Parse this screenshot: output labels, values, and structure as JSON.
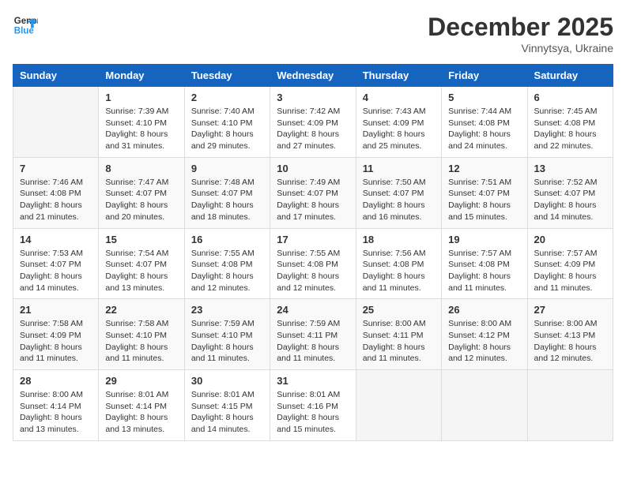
{
  "header": {
    "logo_line1": "General",
    "logo_line2": "Blue",
    "month_year": "December 2025",
    "location": "Vinnytsya, Ukraine"
  },
  "weekdays": [
    "Sunday",
    "Monday",
    "Tuesday",
    "Wednesday",
    "Thursday",
    "Friday",
    "Saturday"
  ],
  "weeks": [
    [
      {
        "day": "",
        "sunrise": "",
        "sunset": "",
        "daylight": ""
      },
      {
        "day": "1",
        "sunrise": "7:39 AM",
        "sunset": "4:10 PM",
        "daylight": "8 hours and 31 minutes."
      },
      {
        "day": "2",
        "sunrise": "7:40 AM",
        "sunset": "4:10 PM",
        "daylight": "8 hours and 29 minutes."
      },
      {
        "day": "3",
        "sunrise": "7:42 AM",
        "sunset": "4:09 PM",
        "daylight": "8 hours and 27 minutes."
      },
      {
        "day": "4",
        "sunrise": "7:43 AM",
        "sunset": "4:09 PM",
        "daylight": "8 hours and 25 minutes."
      },
      {
        "day": "5",
        "sunrise": "7:44 AM",
        "sunset": "4:08 PM",
        "daylight": "8 hours and 24 minutes."
      },
      {
        "day": "6",
        "sunrise": "7:45 AM",
        "sunset": "4:08 PM",
        "daylight": "8 hours and 22 minutes."
      }
    ],
    [
      {
        "day": "7",
        "sunrise": "7:46 AM",
        "sunset": "4:08 PM",
        "daylight": "8 hours and 21 minutes."
      },
      {
        "day": "8",
        "sunrise": "7:47 AM",
        "sunset": "4:07 PM",
        "daylight": "8 hours and 20 minutes."
      },
      {
        "day": "9",
        "sunrise": "7:48 AM",
        "sunset": "4:07 PM",
        "daylight": "8 hours and 18 minutes."
      },
      {
        "day": "10",
        "sunrise": "7:49 AM",
        "sunset": "4:07 PM",
        "daylight": "8 hours and 17 minutes."
      },
      {
        "day": "11",
        "sunrise": "7:50 AM",
        "sunset": "4:07 PM",
        "daylight": "8 hours and 16 minutes."
      },
      {
        "day": "12",
        "sunrise": "7:51 AM",
        "sunset": "4:07 PM",
        "daylight": "8 hours and 15 minutes."
      },
      {
        "day": "13",
        "sunrise": "7:52 AM",
        "sunset": "4:07 PM",
        "daylight": "8 hours and 14 minutes."
      }
    ],
    [
      {
        "day": "14",
        "sunrise": "7:53 AM",
        "sunset": "4:07 PM",
        "daylight": "8 hours and 14 minutes."
      },
      {
        "day": "15",
        "sunrise": "7:54 AM",
        "sunset": "4:07 PM",
        "daylight": "8 hours and 13 minutes."
      },
      {
        "day": "16",
        "sunrise": "7:55 AM",
        "sunset": "4:08 PM",
        "daylight": "8 hours and 12 minutes."
      },
      {
        "day": "17",
        "sunrise": "7:55 AM",
        "sunset": "4:08 PM",
        "daylight": "8 hours and 12 minutes."
      },
      {
        "day": "18",
        "sunrise": "7:56 AM",
        "sunset": "4:08 PM",
        "daylight": "8 hours and 11 minutes."
      },
      {
        "day": "19",
        "sunrise": "7:57 AM",
        "sunset": "4:08 PM",
        "daylight": "8 hours and 11 minutes."
      },
      {
        "day": "20",
        "sunrise": "7:57 AM",
        "sunset": "4:09 PM",
        "daylight": "8 hours and 11 minutes."
      }
    ],
    [
      {
        "day": "21",
        "sunrise": "7:58 AM",
        "sunset": "4:09 PM",
        "daylight": "8 hours and 11 minutes."
      },
      {
        "day": "22",
        "sunrise": "7:58 AM",
        "sunset": "4:10 PM",
        "daylight": "8 hours and 11 minutes."
      },
      {
        "day": "23",
        "sunrise": "7:59 AM",
        "sunset": "4:10 PM",
        "daylight": "8 hours and 11 minutes."
      },
      {
        "day": "24",
        "sunrise": "7:59 AM",
        "sunset": "4:11 PM",
        "daylight": "8 hours and 11 minutes."
      },
      {
        "day": "25",
        "sunrise": "8:00 AM",
        "sunset": "4:11 PM",
        "daylight": "8 hours and 11 minutes."
      },
      {
        "day": "26",
        "sunrise": "8:00 AM",
        "sunset": "4:12 PM",
        "daylight": "8 hours and 12 minutes."
      },
      {
        "day": "27",
        "sunrise": "8:00 AM",
        "sunset": "4:13 PM",
        "daylight": "8 hours and 12 minutes."
      }
    ],
    [
      {
        "day": "28",
        "sunrise": "8:00 AM",
        "sunset": "4:14 PM",
        "daylight": "8 hours and 13 minutes."
      },
      {
        "day": "29",
        "sunrise": "8:01 AM",
        "sunset": "4:14 PM",
        "daylight": "8 hours and 13 minutes."
      },
      {
        "day": "30",
        "sunrise": "8:01 AM",
        "sunset": "4:15 PM",
        "daylight": "8 hours and 14 minutes."
      },
      {
        "day": "31",
        "sunrise": "8:01 AM",
        "sunset": "4:16 PM",
        "daylight": "8 hours and 15 minutes."
      },
      {
        "day": "",
        "sunrise": "",
        "sunset": "",
        "daylight": ""
      },
      {
        "day": "",
        "sunrise": "",
        "sunset": "",
        "daylight": ""
      },
      {
        "day": "",
        "sunrise": "",
        "sunset": "",
        "daylight": ""
      }
    ]
  ],
  "labels": {
    "sunrise_prefix": "Sunrise: ",
    "sunset_prefix": "Sunset: ",
    "daylight_prefix": "Daylight: "
  }
}
